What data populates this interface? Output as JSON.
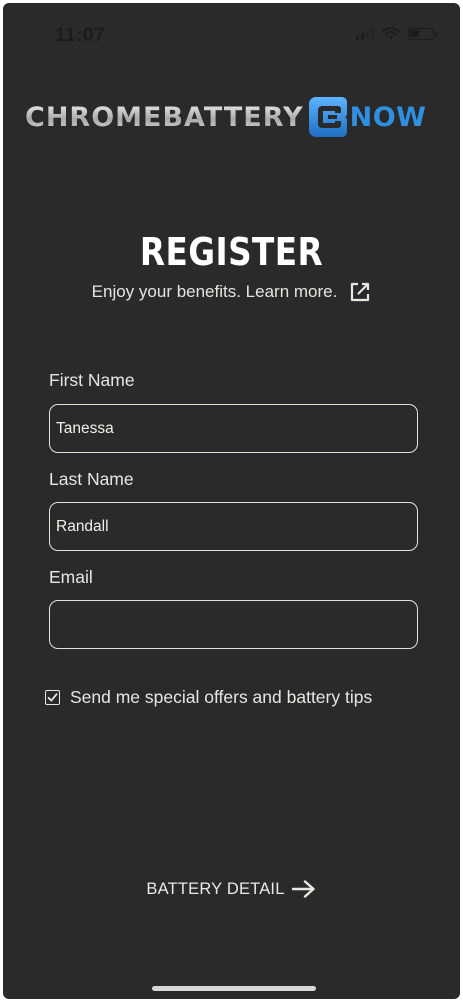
{
  "status_bar": {
    "time": "11:07",
    "battery_level": 0.45,
    "icons": [
      "signal-icon",
      "wifi-icon",
      "battery-icon"
    ]
  },
  "logo": {
    "part1": "CHROMEBATTERY",
    "mark": "CB",
    "part2": "NOW"
  },
  "header": {
    "title": "REGISTER",
    "subtitle": "Enjoy your benefits. Learn more.",
    "link_icon": "external-link-icon"
  },
  "form": {
    "first_name": {
      "label": "First Name",
      "value": "Tanessa"
    },
    "last_name": {
      "label": "Last Name",
      "value": "Randall"
    },
    "email": {
      "label": "Email",
      "value": ""
    },
    "offers_checkbox": {
      "label": "Send me special offers and battery tips",
      "checked": true
    }
  },
  "footer": {
    "next_label": "BATTERY DETAIL",
    "next_icon": "arrow-right-icon"
  },
  "colors": {
    "background": "#2a2a2a",
    "text": "#e8e6e1",
    "accent": "#2f8fe0"
  }
}
